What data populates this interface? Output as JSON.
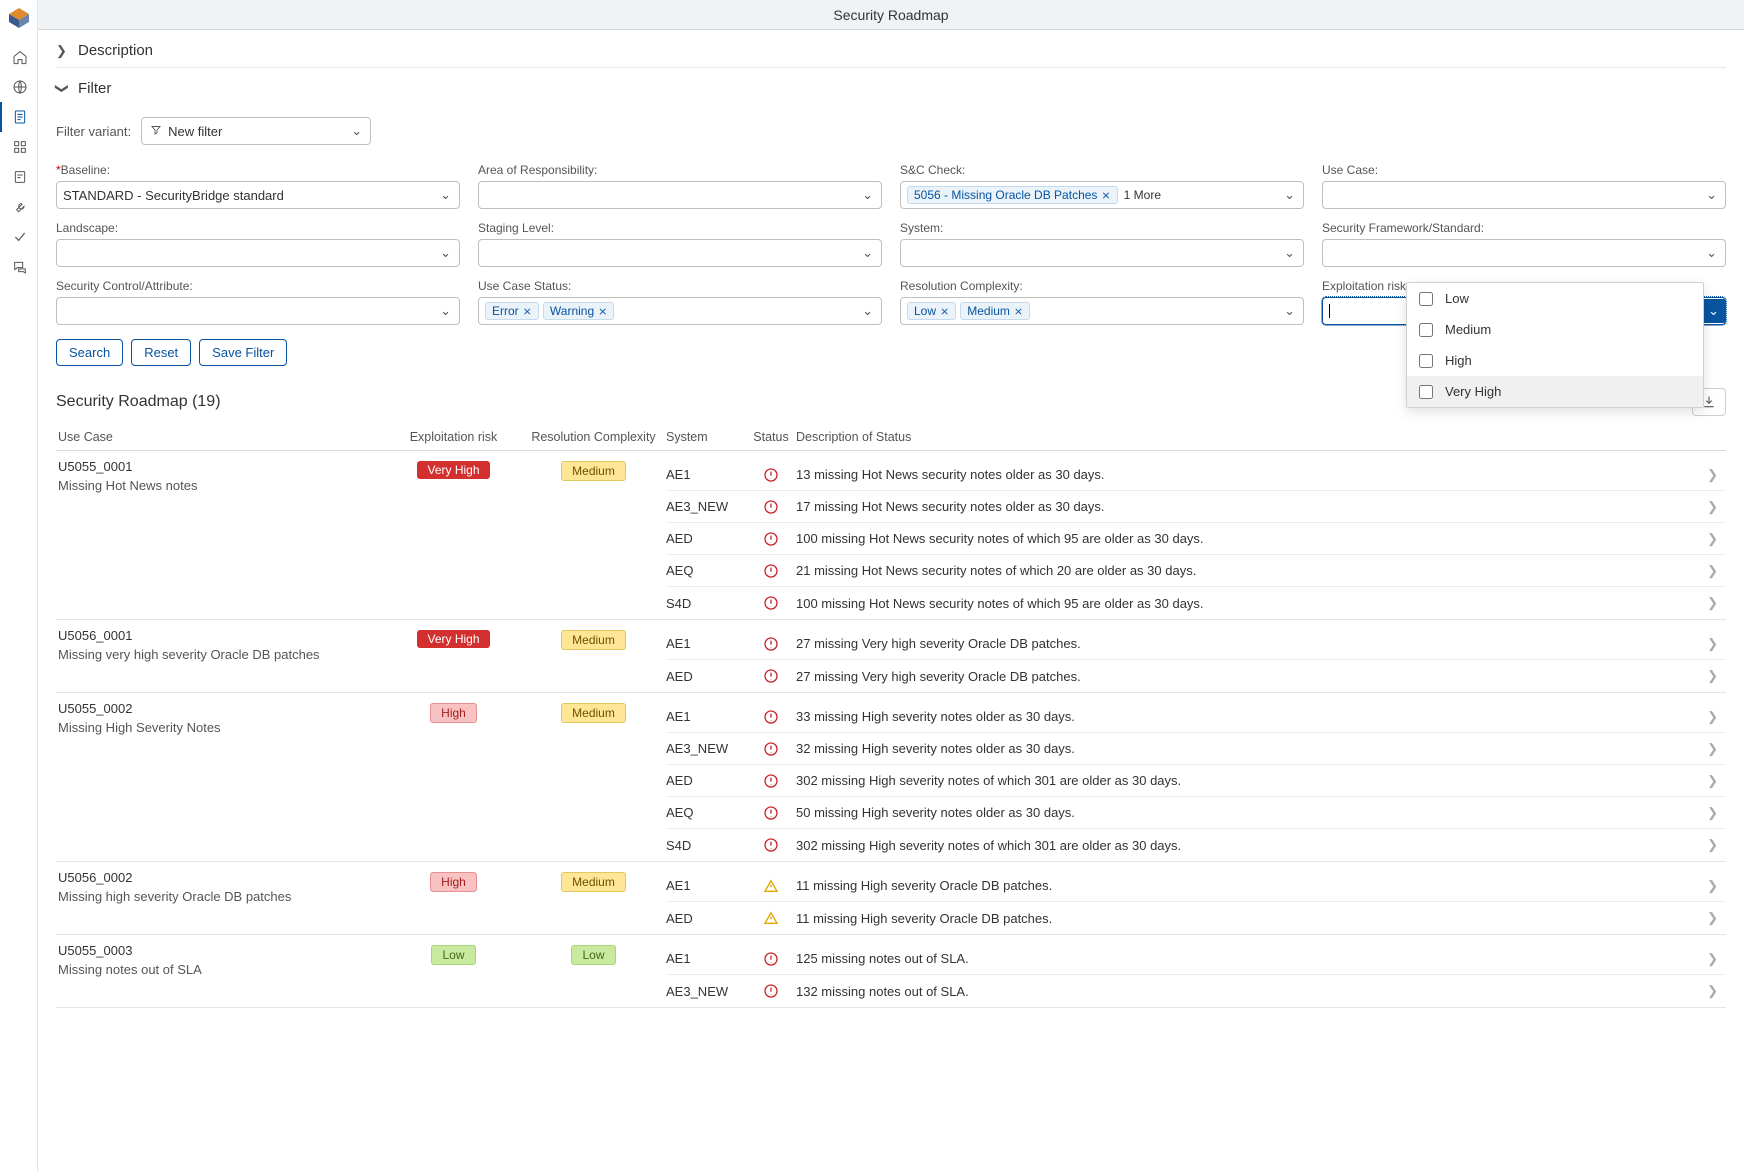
{
  "header": {
    "title": "Security Roadmap"
  },
  "sections": {
    "description": "Description",
    "filter": "Filter"
  },
  "filterVariant": {
    "label": "Filter variant:",
    "value": "New filter"
  },
  "filters": {
    "baseline": {
      "label": "Baseline:",
      "required": true,
      "value": "STANDARD - SecurityBridge standard"
    },
    "areaOfResp": {
      "label": "Area of Responsibility:"
    },
    "scCheck": {
      "label": "S&C Check:",
      "tokens": [
        "5056 - Missing Oracle DB Patches"
      ],
      "more": "1 More"
    },
    "useCase": {
      "label": "Use Case:"
    },
    "landscape": {
      "label": "Landscape:"
    },
    "stagingLevel": {
      "label": "Staging Level:"
    },
    "system": {
      "label": "System:"
    },
    "framework": {
      "label": "Security Framework/Standard:"
    },
    "securityControl": {
      "label": "Security Control/Attribute:"
    },
    "useCaseStatus": {
      "label": "Use Case Status:",
      "tokens": [
        "Error",
        "Warning"
      ]
    },
    "resolutionComplexity": {
      "label": "Resolution Complexity:",
      "tokens": [
        "Low",
        "Medium"
      ]
    },
    "exploitationRisk": {
      "label": "Exploitation risk:"
    }
  },
  "actions": {
    "search": "Search",
    "reset": "Reset",
    "save": "Save Filter"
  },
  "table": {
    "title": "Security Roadmap (19)",
    "columns": {
      "useCase": "Use Case",
      "risk": "Exploitation risk",
      "res": "Resolution Complexity",
      "system": "System",
      "status": "Status",
      "desc": "Description of Status"
    }
  },
  "dropdown": {
    "opt1": "Low",
    "opt2": "Medium",
    "opt3": "High",
    "opt4": "Very High"
  },
  "groups": [
    {
      "id": "U5055_0001",
      "title": "Missing Hot News notes",
      "risk": "Very High",
      "riskClass": "b-veryhigh",
      "res": "Medium",
      "resClass": "b-medium",
      "rows": [
        {
          "sys": "AE1",
          "desc": "13 missing Hot News security notes older as 30 days.",
          "st": "err"
        },
        {
          "sys": "AE3_NEW",
          "desc": "17 missing Hot News security notes older as 30 days.",
          "st": "err"
        },
        {
          "sys": "AED",
          "desc": "100 missing Hot News security notes of which 95 are older as 30 days.",
          "st": "err"
        },
        {
          "sys": "AEQ",
          "desc": "21 missing Hot News security notes of which 20 are older as 30 days.",
          "st": "err"
        },
        {
          "sys": "S4D",
          "desc": "100 missing Hot News security notes of which 95 are older as 30 days.",
          "st": "err"
        }
      ]
    },
    {
      "id": "U5056_0001",
      "title": "Missing very high severity Oracle DB patches",
      "risk": "Very High",
      "riskClass": "b-veryhigh",
      "res": "Medium",
      "resClass": "b-medium",
      "rows": [
        {
          "sys": "AE1",
          "desc": "27 missing Very high severity Oracle DB patches.",
          "st": "err"
        },
        {
          "sys": "AED",
          "desc": "27 missing Very high severity Oracle DB patches.",
          "st": "err"
        }
      ]
    },
    {
      "id": "U5055_0002",
      "title": "Missing High Severity Notes",
      "risk": "High",
      "riskClass": "b-high",
      "res": "Medium",
      "resClass": "b-medium",
      "rows": [
        {
          "sys": "AE1",
          "desc": "33 missing High severity notes older as 30 days.",
          "st": "err"
        },
        {
          "sys": "AE3_NEW",
          "desc": "32 missing High severity notes older as 30 days.",
          "st": "err"
        },
        {
          "sys": "AED",
          "desc": "302 missing High severity notes of which 301 are older as 30 days.",
          "st": "err"
        },
        {
          "sys": "AEQ",
          "desc": "50 missing High severity notes older as 30 days.",
          "st": "err"
        },
        {
          "sys": "S4D",
          "desc": "302 missing High severity notes of which 301 are older as 30 days.",
          "st": "err"
        }
      ]
    },
    {
      "id": "U5056_0002",
      "title": "Missing high severity Oracle DB patches",
      "risk": "High",
      "riskClass": "b-high",
      "res": "Medium",
      "resClass": "b-medium",
      "rows": [
        {
          "sys": "AE1",
          "desc": "11 missing High severity Oracle DB patches.",
          "st": "warn"
        },
        {
          "sys": "AED",
          "desc": "11 missing High severity Oracle DB patches.",
          "st": "warn"
        }
      ]
    },
    {
      "id": "U5055_0003",
      "title": "Missing notes out of SLA",
      "risk": "Low",
      "riskClass": "b-low",
      "res": "Low",
      "resClass": "b-low",
      "rows": [
        {
          "sys": "AE1",
          "desc": "125 missing notes out of SLA.",
          "st": "err"
        },
        {
          "sys": "AE3_NEW",
          "desc": "132 missing notes out of SLA.",
          "st": "err"
        }
      ]
    }
  ]
}
